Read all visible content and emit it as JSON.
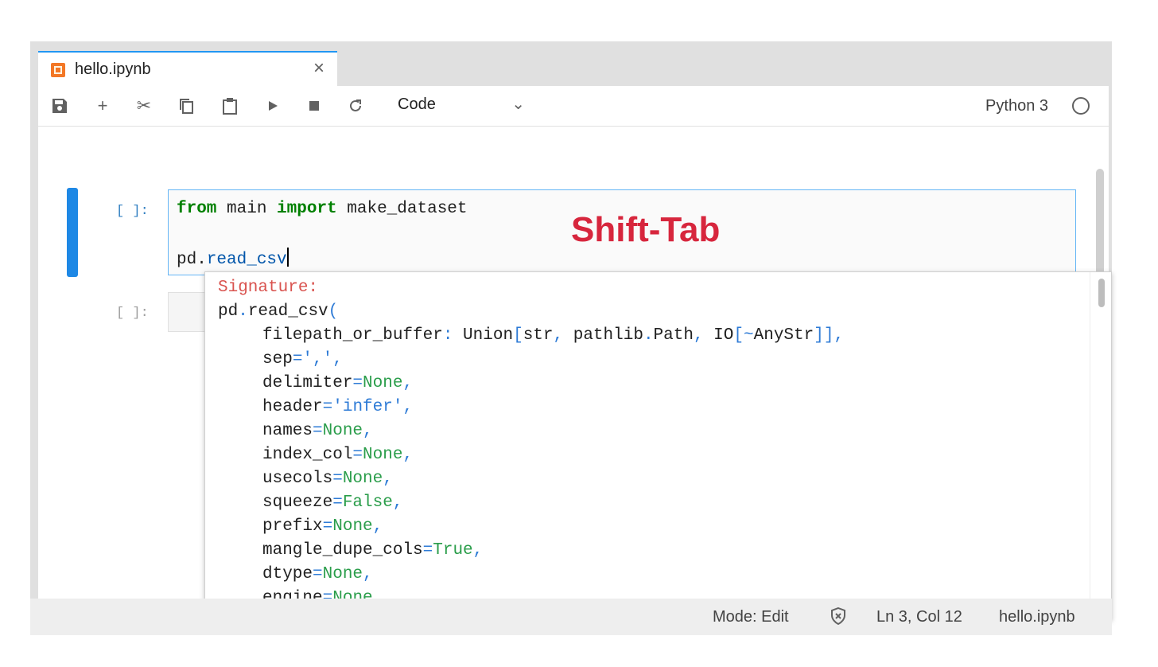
{
  "tab": {
    "title": "hello.ipynb",
    "close": "×"
  },
  "toolbar": {
    "icons": [
      "save-icon",
      "add-icon",
      "cut-icon",
      "copy-icon",
      "paste-icon",
      "run-icon",
      "stop-icon",
      "restart-icon"
    ],
    "cell_type": "Code",
    "kernel_name": "Python 3"
  },
  "cells": [
    {
      "prompt": "[ ]:",
      "lines": [
        "from main import make_dataset",
        "",
        "pd.read_csv"
      ]
    },
    {
      "prompt": "[ ]:"
    }
  ],
  "overlay_label": "Shift-Tab",
  "tooltip": {
    "signature_label": "Signature:",
    "call": "pd.read_csv(",
    "params": [
      "filepath_or_buffer: Union[str, pathlib.Path, IO[~AnyStr]],",
      "sep=',',",
      "delimiter=None,",
      "header='infer',",
      "names=None,",
      "index_col=None,",
      "usecols=None,",
      "squeeze=False,",
      "prefix=None,",
      "mangle_dupe_cols=True,",
      "dtype=None,",
      "engine=None,"
    ]
  },
  "status": {
    "mode": "Mode: Edit",
    "position": "Ln 3, Col 12",
    "filename": "hello.ipynb"
  },
  "colors": {
    "accent": "#1e88e5",
    "overlay": "#d7263d",
    "keyword": "#008000"
  }
}
